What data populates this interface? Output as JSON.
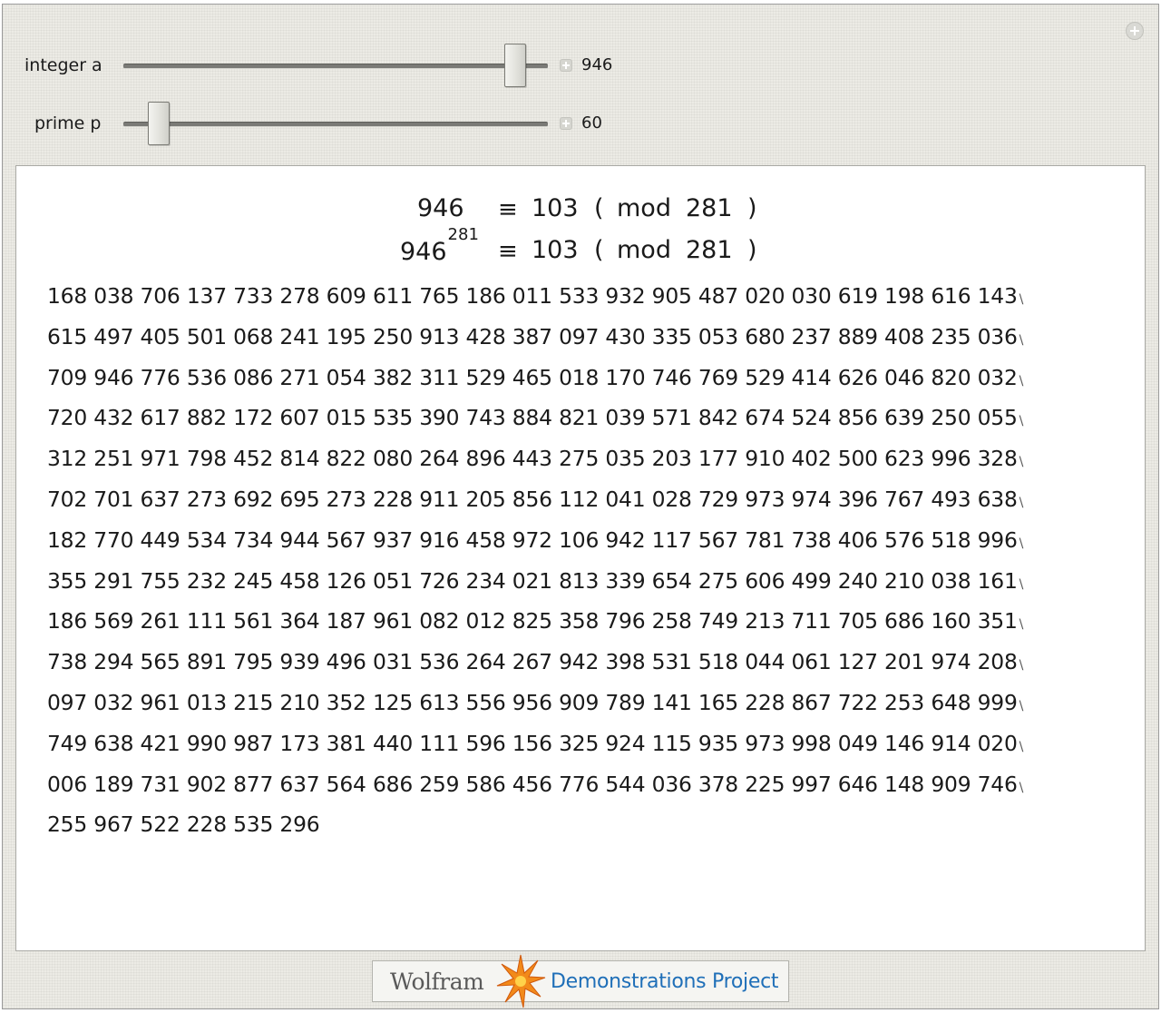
{
  "controls": {
    "integer_a": {
      "label": "integer a",
      "value": "946",
      "slider_fraction": 0.947
    },
    "prime_p": {
      "label": "prime p",
      "value": "60",
      "slider_fraction": 0.06
    }
  },
  "output": {
    "line1": {
      "lhs": "946",
      "equiv": "≡",
      "result": "103",
      "open": "(",
      "mod": "mod",
      "modulus": "281",
      "close": ")"
    },
    "line2": {
      "base": "946",
      "exponent": "281",
      "equiv": "≡",
      "result": "103",
      "open": "(",
      "mod": "mod",
      "modulus": "281",
      "close": ")"
    },
    "continuation_mark": "\\",
    "digit_lines": [
      "168 038 706 137 733 278 609 611 765 186 011 533 932 905 487 020 030 619 198 616 143",
      "615 497 405 501 068 241 195 250 913 428 387 097 430 335 053 680 237 889 408 235 036",
      "709 946 776 536 086 271 054 382 311 529 465 018 170 746 769 529 414 626 046 820 032",
      "720 432 617 882 172 607 015 535 390 743 884 821 039 571 842 674 524 856 639 250 055",
      "312 251 971 798 452 814 822 080 264 896 443 275 035 203 177 910 402 500 623 996 328",
      "702 701 637 273 692 695 273 228 911 205 856 112 041 028 729 973 974 396 767 493 638",
      "182 770 449 534 734 944 567 937 916 458 972 106 942 117 567 781 738 406 576 518 996",
      "355 291 755 232 245 458 126 051 726 234 021 813 339 654 275 606 499 240 210 038 161",
      "186 569 261 111 561 364 187 961 082 012 825 358 796 258 749 213 711 705 686 160 351",
      "738 294 565 891 795 939 496 031 536 264 267 942 398 531 518 044 061 127 201 974 208",
      "097 032 961 013 215 210 352 125 613 556 956 909 789 141 165 228 867 722 253 648 999",
      "749 638 421 990 987 173 381 440 111 596 156 325 924 115 935 973 998 049 146 914 020",
      "006 189 731 902 877 637 564 686 259 586 456 776 544 036 378 225 997 646 148 909 746",
      "255 967 522 228 535 296"
    ]
  },
  "footer": {
    "wolfram": "Wolfram",
    "demonstrations": "Demonstrations Project"
  },
  "colors": {
    "panel_bg": "#ecebe5",
    "link_blue": "#1f6fb8",
    "star_orange": "#f28a1a"
  }
}
